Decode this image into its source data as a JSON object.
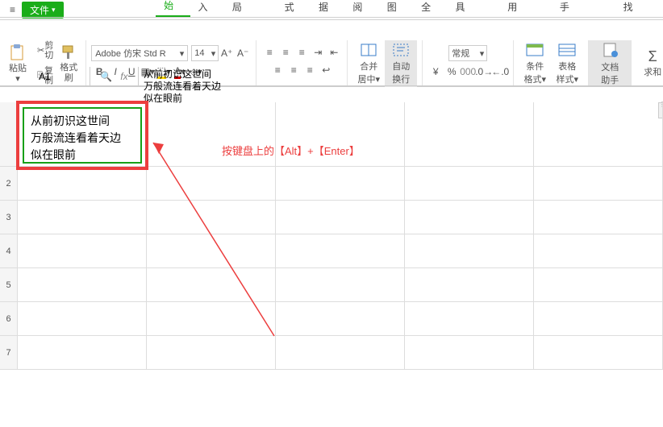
{
  "topbar": {
    "file_label": "文件"
  },
  "tabs": {
    "start": "开始",
    "insert": "插入",
    "layout": "页面布局",
    "formula": "公式",
    "data": "数据",
    "review": "审阅",
    "view": "视图",
    "security": "安全",
    "dev": "开发工具",
    "special": "特色应用",
    "helper": "文档助手",
    "find": "查找"
  },
  "ribbon": {
    "cut": "剪切",
    "copy": "复制",
    "paste": "粘贴",
    "fmtpainter": "格式刷",
    "font_name": "Adobe 仿宋 Std R",
    "font_size": "14",
    "merge_center": "合并居中",
    "autowrap": "自动换行",
    "numfmt": "常规",
    "condfmt": "条件格式",
    "tablestyle": "表格样式",
    "symbol_cny": "¥",
    "symbol_pct": "%",
    "dochelper": "文档助手",
    "sum": "求和"
  },
  "namebox": "A1",
  "fx": "fx",
  "formula_bar": "从前初识这世间\n万般流连看着天边\n似在眼前",
  "cell_content": {
    "line1": "从前初识这世间",
    "line2": "万般流连看着天边",
    "line3": "似在眼前"
  },
  "rows": [
    "",
    "2",
    "3",
    "4",
    "5",
    "6",
    "7"
  ],
  "annotation": "按键盘上的【Alt】+【Enter】"
}
